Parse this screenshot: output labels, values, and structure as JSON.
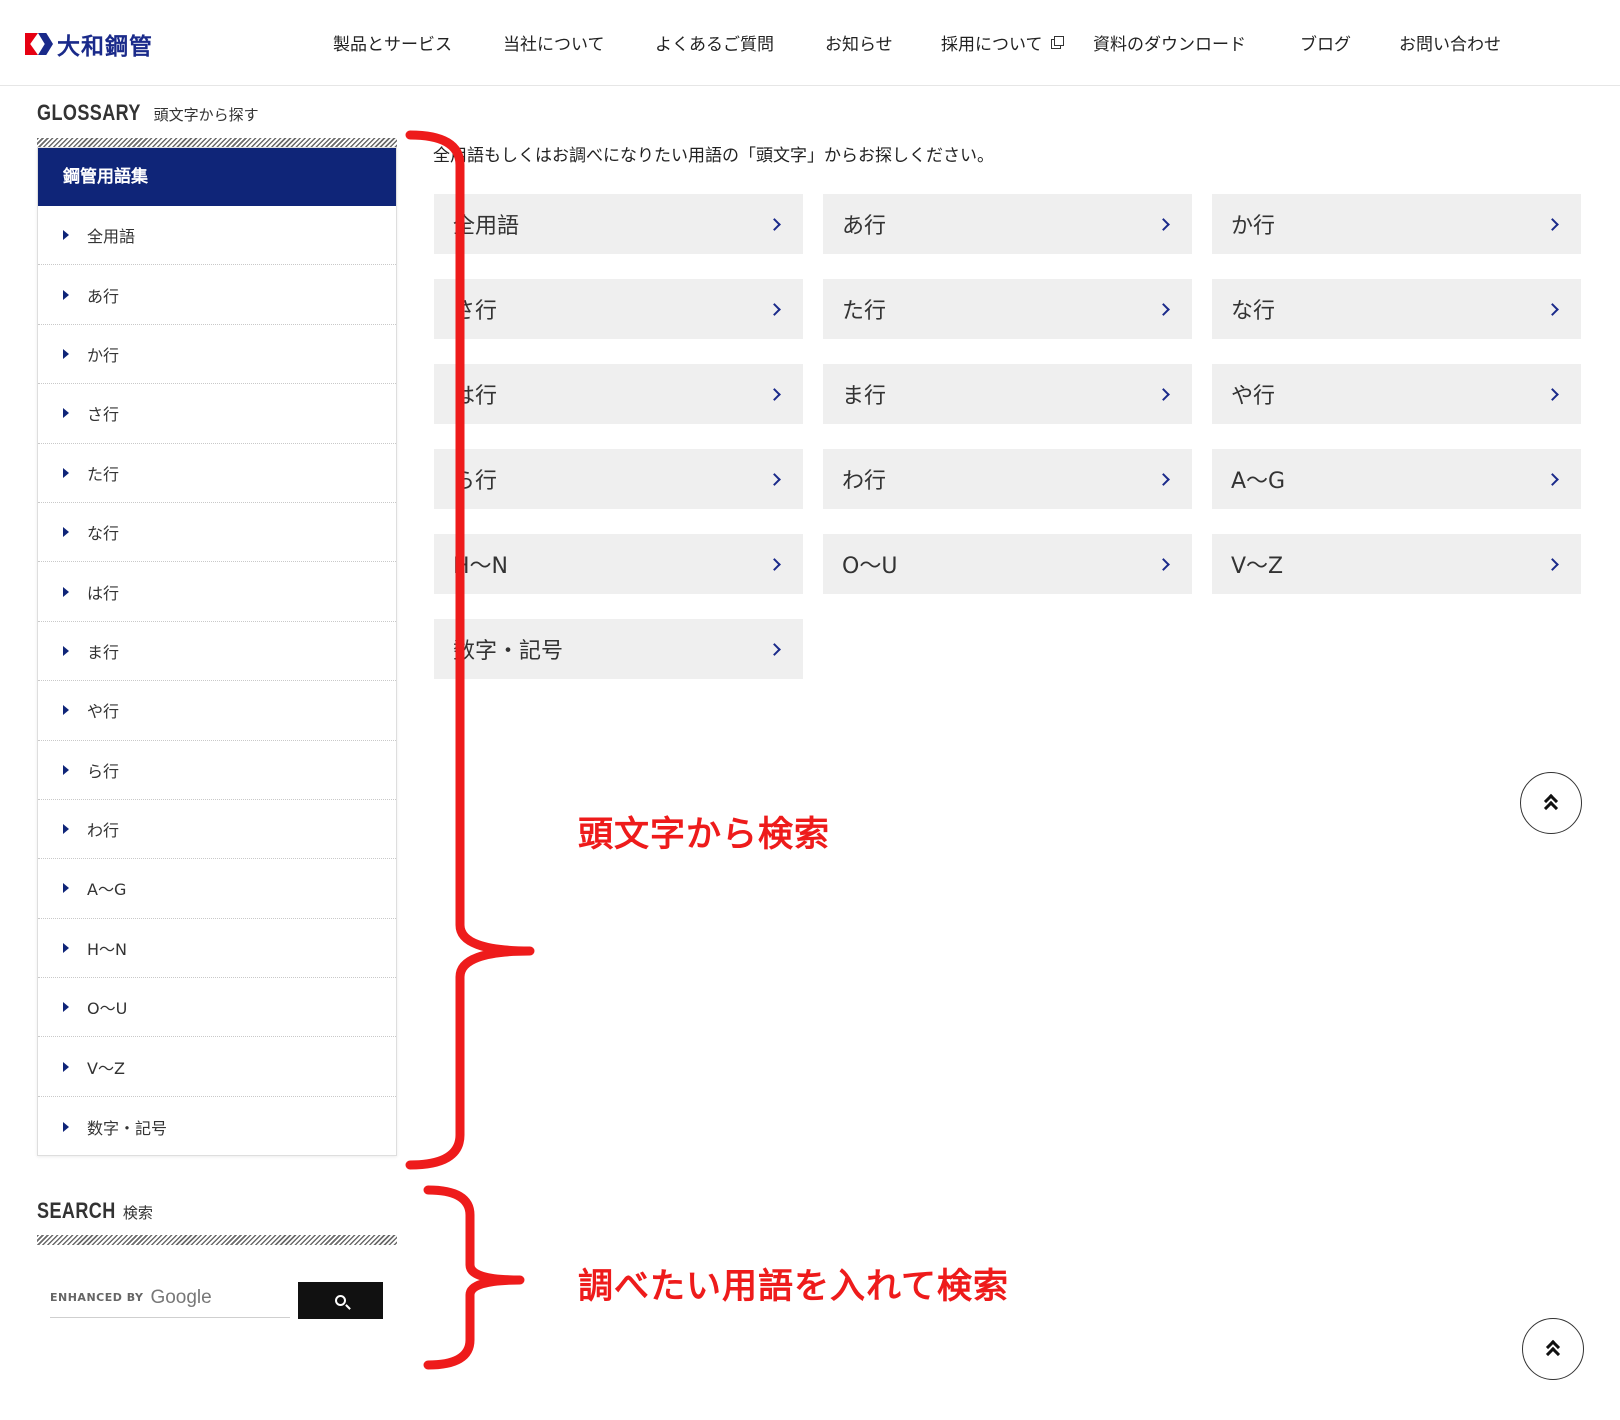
{
  "header": {
    "logo_text": "大和鋼管",
    "nav": [
      {
        "label": "製品とサービス"
      },
      {
        "label": "当社について"
      },
      {
        "label": "よくあるご質問"
      },
      {
        "label": "お知らせ"
      },
      {
        "label": "採用について",
        "external": true
      },
      {
        "label": "資料のダウンロード"
      },
      {
        "label": "ブログ"
      },
      {
        "label": "お問い合わせ"
      }
    ]
  },
  "glossary": {
    "title_en": "GLOSSARY",
    "title_ja": "頭文字から探す",
    "sidebar_heading": "鋼管用語集",
    "items": [
      "全用語",
      "あ行",
      "か行",
      "さ行",
      "た行",
      "な行",
      "は行",
      "ま行",
      "や行",
      "ら行",
      "わ行",
      "A〜G",
      "H〜N",
      "O〜U",
      "V〜Z",
      "数字・記号"
    ]
  },
  "main": {
    "intro": "全用語もしくはお調べになりたい用語の「頭文字」からお探しください。",
    "buttons": [
      "全用語",
      "あ行",
      "か行",
      "さ行",
      "た行",
      "な行",
      "は行",
      "ま行",
      "や行",
      "ら行",
      "わ行",
      "A〜G",
      "H〜N",
      "O〜U",
      "V〜Z",
      "数字・記号"
    ]
  },
  "search": {
    "title_en": "SEARCH",
    "title_ja": "検索",
    "enhanced_by": "ENHANCED BY",
    "google": "Google"
  },
  "annotations": {
    "initial_search": "頭文字から検索",
    "term_search": "調べたい用語を入れて検索",
    "color": "#ee1b1b"
  },
  "colors": {
    "brand_navy": "#0f2578",
    "button_bg": "#efefef"
  },
  "icons": {
    "nav_external": "external-link-icon",
    "list_marker": "triangle-right-icon",
    "button_arrow": "chevron-right-icon",
    "search": "search-icon",
    "page_top": "double-chevron-up-icon"
  }
}
